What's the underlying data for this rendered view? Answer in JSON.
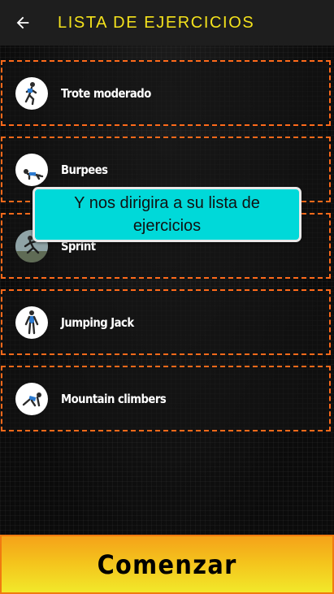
{
  "header": {
    "title": "LISTA DE EJERCICIOS",
    "back_icon": "arrow-left-icon"
  },
  "exercises": [
    {
      "label": "Trote moderado",
      "thumb": "runner-thumbnail"
    },
    {
      "label": "Burpees",
      "thumb": "burpee-thumbnail"
    },
    {
      "label": "Sprint",
      "thumb": "sprint-thumbnail"
    },
    {
      "label": "Jumping Jack",
      "thumb": "jumping-jack-thumbnail"
    },
    {
      "label": "Mountain climbers",
      "thumb": "mountain-climber-thumbnail"
    }
  ],
  "tooltip": {
    "text": "Y nos dirigira a su lista de ejercicios"
  },
  "footer": {
    "start_label": "Comenzar"
  },
  "colors": {
    "title": "#f4e21c",
    "item_border": "#ff6a1a",
    "tooltip_bg": "#00d9d9",
    "button_top": "#f5a21a",
    "button_bottom": "#f2e82a"
  }
}
